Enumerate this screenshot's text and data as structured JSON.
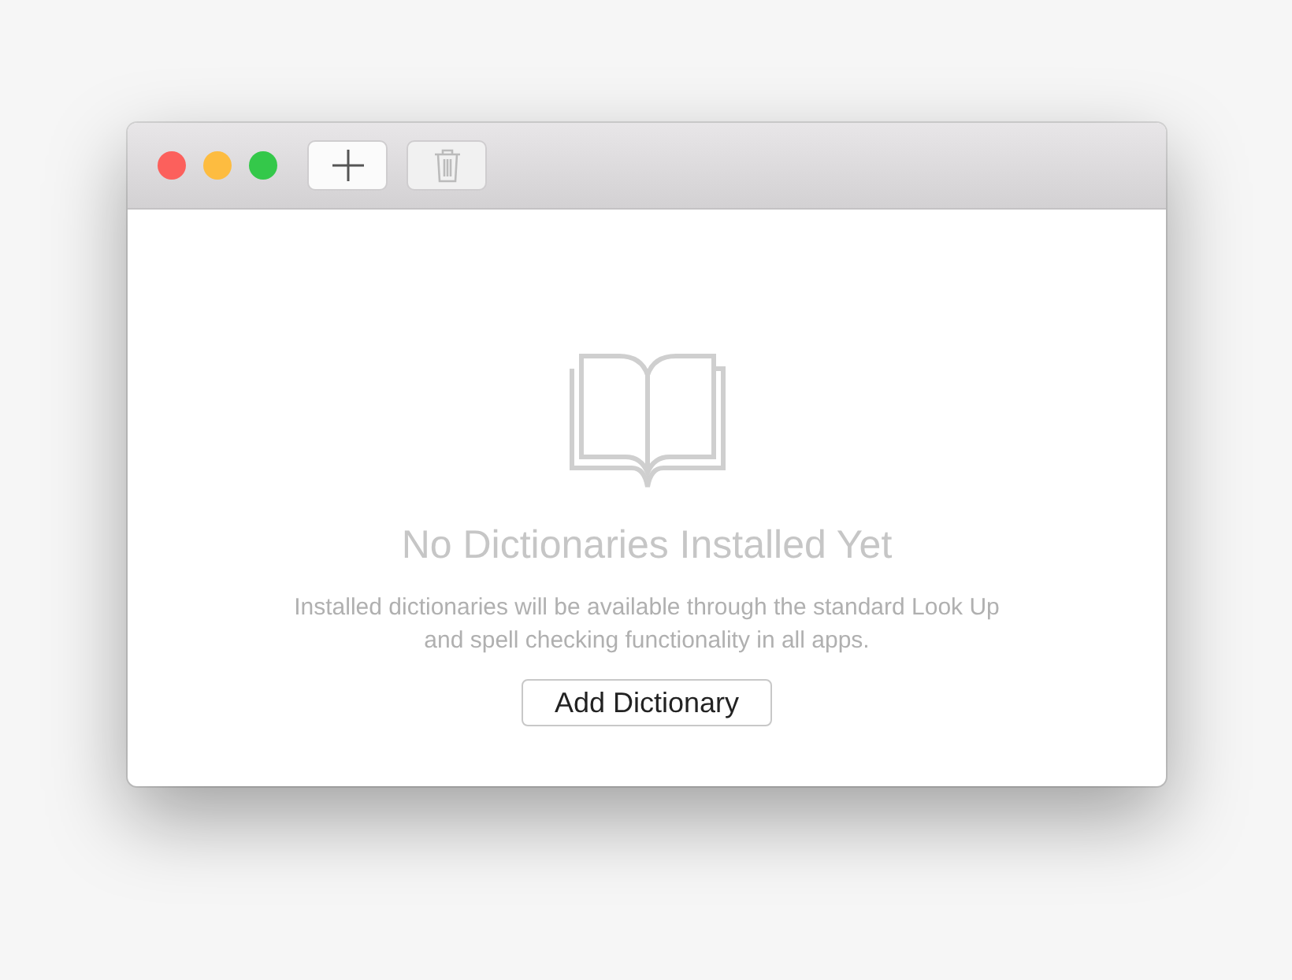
{
  "toolbar": {
    "buttons": [
      {
        "kind": "add",
        "disabled": false
      },
      {
        "kind": "trash",
        "disabled": true
      }
    ]
  },
  "empty_state": {
    "title": "No Dictionaries Installed Yet",
    "description": "Installed dictionaries will be available through the standard Look Up and spell checking functionality in all apps.",
    "button": "Add Dictionary"
  }
}
